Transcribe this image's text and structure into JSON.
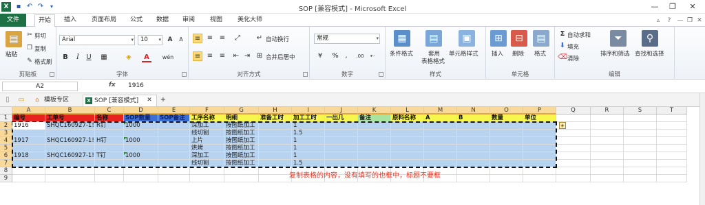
{
  "window": {
    "title": "SOP [兼容模式] - Microsoft Excel",
    "minimize": "—",
    "restore": "❐",
    "close": "✕"
  },
  "ribbon_tabs": [
    "文件",
    "开始",
    "插入",
    "页面布局",
    "公式",
    "数据",
    "审阅",
    "视图",
    "美化大师"
  ],
  "clipboard": {
    "paste": "粘贴",
    "cut": "剪切",
    "copy": "复制",
    "format_painter": "格式刷",
    "label": "剪贴板"
  },
  "font": {
    "name": "Arial",
    "size": "10",
    "label": "字体",
    "bold": "B",
    "italic": "I",
    "underline": "U",
    "grow": "A",
    "shrink": "A",
    "font_color_glyph": "A",
    "phonetic": "wén"
  },
  "alignment": {
    "wrap": "自动换行",
    "merge": "合并后居中",
    "label": "对齐方式"
  },
  "number": {
    "format": "常规",
    "percent": "%",
    "comma": ",",
    "inc": ".00",
    "label": "数字"
  },
  "styles": {
    "conditional": "条件格式",
    "table_line1": "套用",
    "table_line2": "表格格式",
    "cell_styles": "单元格样式",
    "label": "样式"
  },
  "cells": {
    "insert": "插入",
    "delete": "删除",
    "format": "格式",
    "label": "单元格"
  },
  "editing": {
    "autosum": "自动求和",
    "fill": "填充",
    "clear": "清除",
    "sort": "排序和筛选",
    "find": "查找和选择",
    "label": "编辑"
  },
  "formula_bar": {
    "name_box": "A2",
    "fx": "fx",
    "value": "1916"
  },
  "doc_tabs": {
    "template": "模板专区",
    "file": "SOP [兼容模式]",
    "close": "✕",
    "add": "+"
  },
  "columns": [
    "A",
    "B",
    "C",
    "D",
    "E",
    "F",
    "G",
    "H",
    "I",
    "J",
    "K",
    "L",
    "M",
    "N",
    "O",
    "P",
    "Q",
    "R",
    "S",
    "T"
  ],
  "rows": [
    "1",
    "2",
    "3",
    "4",
    "5",
    "6",
    "7",
    "8",
    "9"
  ],
  "header_row": [
    {
      "col": "A",
      "text": "编号",
      "color": "#e8231f"
    },
    {
      "col": "B",
      "text": "工单号",
      "color": "#e8231f"
    },
    {
      "col": "C",
      "text": "名称",
      "color": "#e8231f"
    },
    {
      "col": "D",
      "text": "SOP数量",
      "color": "#3a6fd8"
    },
    {
      "col": "E",
      "text": "SOP备注",
      "color": "#3a6fd8"
    },
    {
      "col": "F",
      "text": "工序名称",
      "color": "#f6f64c"
    },
    {
      "col": "G",
      "text": "明细",
      "color": "#f6f64c"
    },
    {
      "col": "H",
      "text": "准备工时",
      "color": "#f6f64c"
    },
    {
      "col": "I",
      "text": "加工工时",
      "color": "#f6f64c"
    },
    {
      "col": "J",
      "text": "一出几",
      "color": "#f6f64c"
    },
    {
      "col": "K",
      "text": "备注",
      "color": "#a8e4a0"
    },
    {
      "col": "L",
      "text": "原料名称",
      "color": "#f6f64c"
    },
    {
      "col": "M",
      "text": "A",
      "color": "#f6f64c"
    },
    {
      "col": "N",
      "text": "B",
      "color": "#f6f64c"
    },
    {
      "col": "O",
      "text": "数量",
      "color": "#f6f64c"
    },
    {
      "col": "P",
      "text": "单位",
      "color": "#f6f64c"
    }
  ],
  "data_rows": [
    {
      "A": "1916",
      "B": "SHQC160927-1!",
      "C": "R钉",
      "D": "1000",
      "F": "深加工",
      "G": "按图纸加工",
      "I": "1"
    },
    {
      "F": "线切割",
      "G": "按图纸加工",
      "I": "1.5"
    },
    {
      "A": "1917",
      "B": "SHQC160927-1!",
      "C": "H钉",
      "D": "1000",
      "F": "上片",
      "G": "按图纸加工",
      "I": "1"
    },
    {
      "F": "烘烤",
      "G": "按图纸加工",
      "I": "1"
    },
    {
      "A": "1918",
      "B": "SHQC160927-1!",
      "C": "T钉",
      "D": "1000",
      "F": "深加工",
      "G": "按图纸加工",
      "I": "1"
    },
    {
      "F": "线切割",
      "G": "按图纸加工",
      "I": "1.5"
    }
  ],
  "note": "复制表格的内容，没有填写的也框中，标题不要框",
  "paste_options_icon": "◈"
}
